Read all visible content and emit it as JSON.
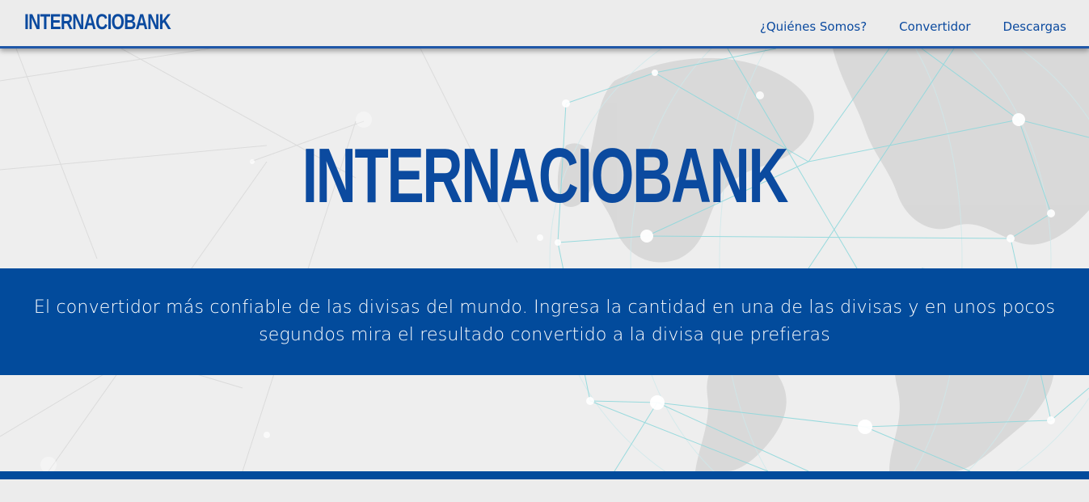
{
  "header": {
    "brand": "INTERNACIOBANK",
    "nav": [
      {
        "label": "¿Quiénes Somos?"
      },
      {
        "label": "Convertidor"
      },
      {
        "label": "Descargas"
      }
    ]
  },
  "hero": {
    "title": "INTERNACIOBANK",
    "tagline": "El convertidor más confiable de las divisas del mundo. Ingresa la cantidad en una de las divisas y en unos pocos segundos mira el resultado convertido a la divisa que prefieras"
  },
  "colors": {
    "brand_blue": "#024b9c",
    "text_blue": "#0b4a9f",
    "background": "#ececec",
    "network_lines": "#7fd4d8"
  }
}
